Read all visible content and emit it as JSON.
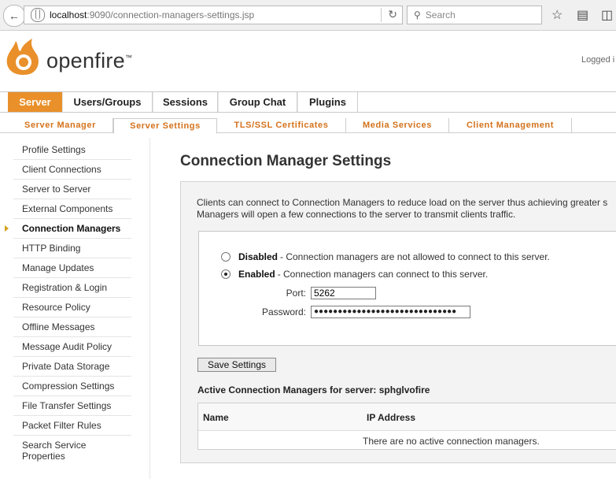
{
  "browser": {
    "url_host": "localhost",
    "url_path": ":9090/connection-managers-settings.jsp",
    "search_placeholder": "Search"
  },
  "header": {
    "logo_text": "openfire",
    "logo_tm": "™",
    "logged_in_text": "Logged i"
  },
  "main_tabs": [
    {
      "label": "Server",
      "active": true
    },
    {
      "label": "Users/Groups"
    },
    {
      "label": "Sessions"
    },
    {
      "label": "Group Chat"
    },
    {
      "label": "Plugins"
    }
  ],
  "sub_tabs": [
    {
      "label": "Server Manager"
    },
    {
      "label": "Server Settings",
      "active": true
    },
    {
      "label": "TLS/SSL Certificates"
    },
    {
      "label": "Media Services"
    },
    {
      "label": "Client Management"
    }
  ],
  "sidebar": {
    "items": [
      {
        "label": "Profile Settings"
      },
      {
        "label": "Client Connections"
      },
      {
        "label": "Server to Server"
      },
      {
        "label": "External Components"
      },
      {
        "label": "Connection Managers",
        "active": true
      },
      {
        "label": "HTTP Binding"
      },
      {
        "label": "Manage Updates"
      },
      {
        "label": "Registration & Login"
      },
      {
        "label": "Resource Policy"
      },
      {
        "label": "Offline Messages"
      },
      {
        "label": "Message Audit Policy"
      },
      {
        "label": "Private Data Storage"
      },
      {
        "label": "Compression Settings"
      },
      {
        "label": "File Transfer Settings"
      },
      {
        "label": "Packet Filter Rules"
      },
      {
        "label": "Search Service Properties"
      }
    ]
  },
  "main": {
    "title": "Connection Manager Settings",
    "intro_line1": "Clients can connect to Connection Managers to reduce load on the server thus achieving greater s",
    "intro_line2": "Managers will open a few connections to the server to transmit clients traffic.",
    "disabled_label": "Disabled",
    "disabled_desc": " - Connection managers are not allowed to connect to this server.",
    "enabled_label": "Enabled",
    "enabled_desc": " - Connection managers can connect to this server.",
    "selected_option": "Enabled",
    "port_label": "Port:",
    "port_value": "5262",
    "password_label": "Password:",
    "password_value": "●●●●●●●●●●●●●●●●●●●●●●●●●●●●●●",
    "save_button": "Save Settings",
    "active_title": "Active Connection Managers for server: sphglvofire",
    "table_headers": [
      "Name",
      "IP Address"
    ],
    "empty_text": "There are no active connection managers."
  },
  "colors": {
    "accent_orange": "#e9902a",
    "subtab_text": "#d4721b"
  }
}
